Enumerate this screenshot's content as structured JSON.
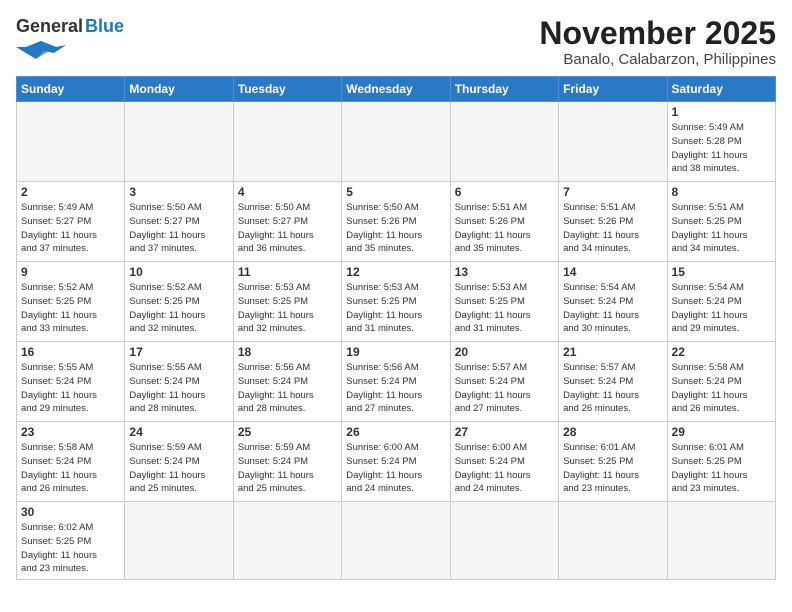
{
  "header": {
    "logo_general": "General",
    "logo_blue": "Blue",
    "month_title": "November 2025",
    "location": "Banalo, Calabarzon, Philippines"
  },
  "weekdays": [
    "Sunday",
    "Monday",
    "Tuesday",
    "Wednesday",
    "Thursday",
    "Friday",
    "Saturday"
  ],
  "weeks": [
    [
      {
        "day": null,
        "info": ""
      },
      {
        "day": null,
        "info": ""
      },
      {
        "day": null,
        "info": ""
      },
      {
        "day": null,
        "info": ""
      },
      {
        "day": null,
        "info": ""
      },
      {
        "day": null,
        "info": ""
      },
      {
        "day": "1",
        "info": "Sunrise: 5:49 AM\nSunset: 5:28 PM\nDaylight: 11 hours\nand 38 minutes."
      }
    ],
    [
      {
        "day": "2",
        "info": "Sunrise: 5:49 AM\nSunset: 5:27 PM\nDaylight: 11 hours\nand 37 minutes."
      },
      {
        "day": "3",
        "info": "Sunrise: 5:50 AM\nSunset: 5:27 PM\nDaylight: 11 hours\nand 37 minutes."
      },
      {
        "day": "4",
        "info": "Sunrise: 5:50 AM\nSunset: 5:27 PM\nDaylight: 11 hours\nand 36 minutes."
      },
      {
        "day": "5",
        "info": "Sunrise: 5:50 AM\nSunset: 5:26 PM\nDaylight: 11 hours\nand 35 minutes."
      },
      {
        "day": "6",
        "info": "Sunrise: 5:51 AM\nSunset: 5:26 PM\nDaylight: 11 hours\nand 35 minutes."
      },
      {
        "day": "7",
        "info": "Sunrise: 5:51 AM\nSunset: 5:26 PM\nDaylight: 11 hours\nand 34 minutes."
      },
      {
        "day": "8",
        "info": "Sunrise: 5:51 AM\nSunset: 5:25 PM\nDaylight: 11 hours\nand 34 minutes."
      }
    ],
    [
      {
        "day": "9",
        "info": "Sunrise: 5:52 AM\nSunset: 5:25 PM\nDaylight: 11 hours\nand 33 minutes."
      },
      {
        "day": "10",
        "info": "Sunrise: 5:52 AM\nSunset: 5:25 PM\nDaylight: 11 hours\nand 32 minutes."
      },
      {
        "day": "11",
        "info": "Sunrise: 5:53 AM\nSunset: 5:25 PM\nDaylight: 11 hours\nand 32 minutes."
      },
      {
        "day": "12",
        "info": "Sunrise: 5:53 AM\nSunset: 5:25 PM\nDaylight: 11 hours\nand 31 minutes."
      },
      {
        "day": "13",
        "info": "Sunrise: 5:53 AM\nSunset: 5:25 PM\nDaylight: 11 hours\nand 31 minutes."
      },
      {
        "day": "14",
        "info": "Sunrise: 5:54 AM\nSunset: 5:24 PM\nDaylight: 11 hours\nand 30 minutes."
      },
      {
        "day": "15",
        "info": "Sunrise: 5:54 AM\nSunset: 5:24 PM\nDaylight: 11 hours\nand 29 minutes."
      }
    ],
    [
      {
        "day": "16",
        "info": "Sunrise: 5:55 AM\nSunset: 5:24 PM\nDaylight: 11 hours\nand 29 minutes."
      },
      {
        "day": "17",
        "info": "Sunrise: 5:55 AM\nSunset: 5:24 PM\nDaylight: 11 hours\nand 28 minutes."
      },
      {
        "day": "18",
        "info": "Sunrise: 5:56 AM\nSunset: 5:24 PM\nDaylight: 11 hours\nand 28 minutes."
      },
      {
        "day": "19",
        "info": "Sunrise: 5:56 AM\nSunset: 5:24 PM\nDaylight: 11 hours\nand 27 minutes."
      },
      {
        "day": "20",
        "info": "Sunrise: 5:57 AM\nSunset: 5:24 PM\nDaylight: 11 hours\nand 27 minutes."
      },
      {
        "day": "21",
        "info": "Sunrise: 5:57 AM\nSunset: 5:24 PM\nDaylight: 11 hours\nand 26 minutes."
      },
      {
        "day": "22",
        "info": "Sunrise: 5:58 AM\nSunset: 5:24 PM\nDaylight: 11 hours\nand 26 minutes."
      }
    ],
    [
      {
        "day": "23",
        "info": "Sunrise: 5:58 AM\nSunset: 5:24 PM\nDaylight: 11 hours\nand 26 minutes."
      },
      {
        "day": "24",
        "info": "Sunrise: 5:59 AM\nSunset: 5:24 PM\nDaylight: 11 hours\nand 25 minutes."
      },
      {
        "day": "25",
        "info": "Sunrise: 5:59 AM\nSunset: 5:24 PM\nDaylight: 11 hours\nand 25 minutes."
      },
      {
        "day": "26",
        "info": "Sunrise: 6:00 AM\nSunset: 5:24 PM\nDaylight: 11 hours\nand 24 minutes."
      },
      {
        "day": "27",
        "info": "Sunrise: 6:00 AM\nSunset: 5:24 PM\nDaylight: 11 hours\nand 24 minutes."
      },
      {
        "day": "28",
        "info": "Sunrise: 6:01 AM\nSunset: 5:25 PM\nDaylight: 11 hours\nand 23 minutes."
      },
      {
        "day": "29",
        "info": "Sunrise: 6:01 AM\nSunset: 5:25 PM\nDaylight: 11 hours\nand 23 minutes."
      }
    ],
    [
      {
        "day": "30",
        "info": "Sunrise: 6:02 AM\nSunset: 5:25 PM\nDaylight: 11 hours\nand 23 minutes."
      },
      {
        "day": null,
        "info": ""
      },
      {
        "day": null,
        "info": ""
      },
      {
        "day": null,
        "info": ""
      },
      {
        "day": null,
        "info": ""
      },
      {
        "day": null,
        "info": ""
      },
      {
        "day": null,
        "info": ""
      }
    ]
  ]
}
